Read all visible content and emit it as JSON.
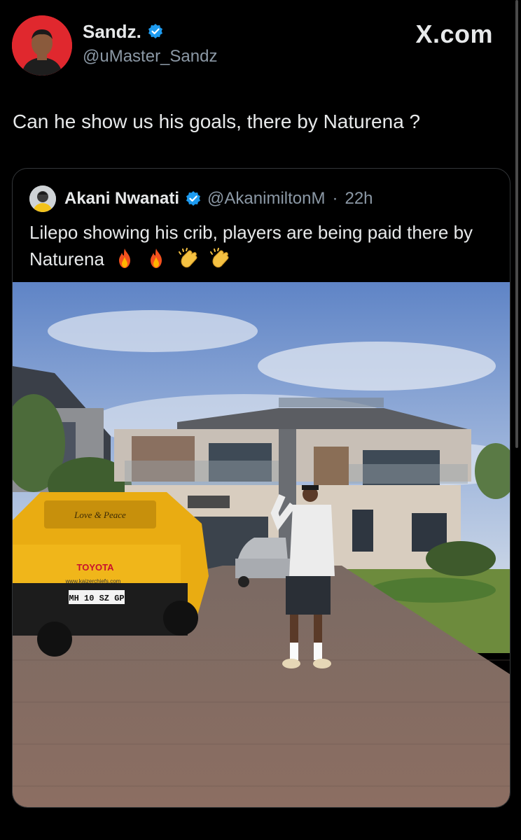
{
  "site": {
    "brand": "X.com"
  },
  "tweet": {
    "author": {
      "name": "Sandz.",
      "handle": "@uMaster_Sandz",
      "avatar_icon": "person-avatar-icon",
      "verified_icon": "verified-badge-icon"
    },
    "text": "Can he show us his goals, there by Naturena ?"
  },
  "quoted_tweet": {
    "author": {
      "name": "Akani Nwanati",
      "handle": "@AkanimiltonM",
      "avatar_icon": "person-avatar-icon",
      "verified_icon": "verified-badge-icon"
    },
    "separator": "·",
    "time": "22h",
    "text": "Lilepo showing his crib, players are being paid there by Naturena",
    "emojis": [
      "fire-icon",
      "fire-icon",
      "clapping-hands-icon",
      "clapping-hands-icon"
    ],
    "photo": {
      "vehicle_badge": "Love & Peace",
      "vehicle_brand": "TOYOTA",
      "vehicle_website": "www.kaizerchiefs.com",
      "license_plate": "MH 10 SZ GP"
    }
  },
  "colors": {
    "background": "#000000",
    "text_primary": "#e7e9ea",
    "text_secondary": "#8b98a5",
    "verified": "#1d9bf0",
    "border": "#333639"
  }
}
